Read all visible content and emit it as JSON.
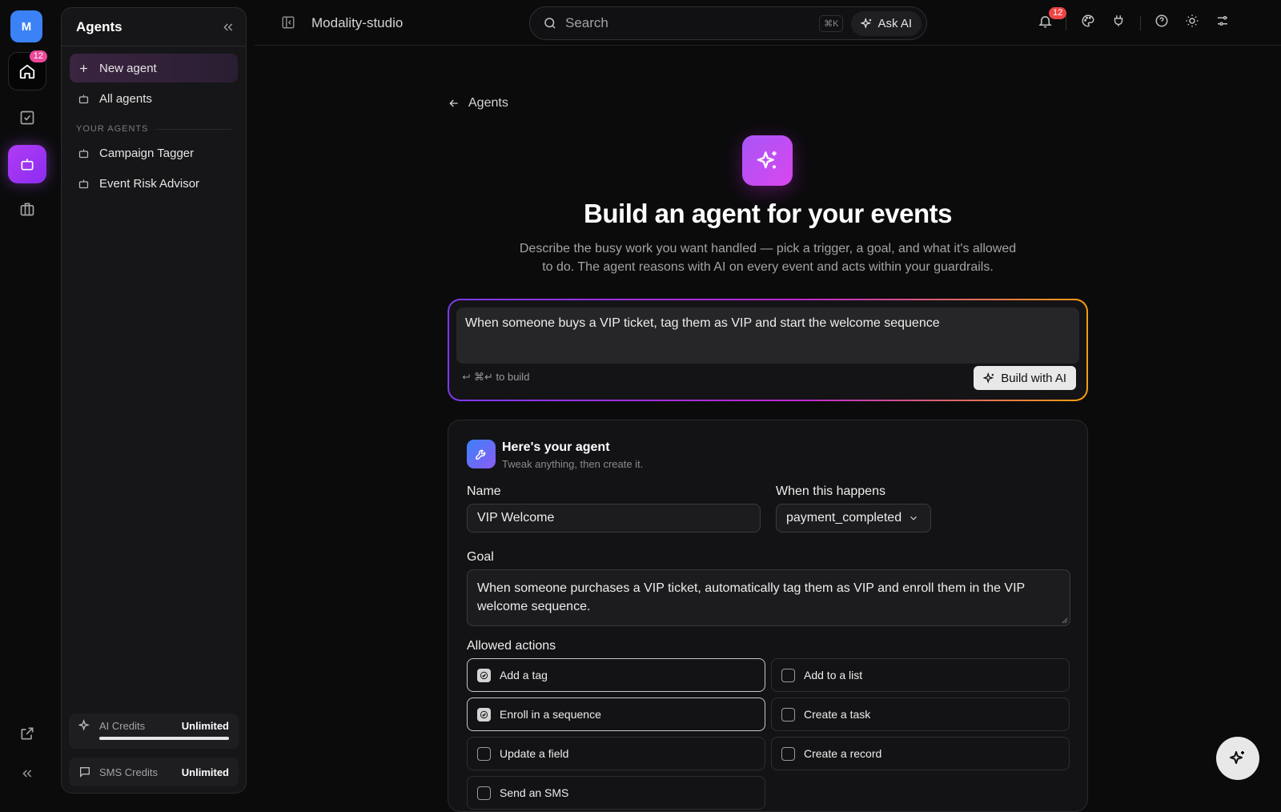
{
  "rail": {
    "avatar_initial": "M",
    "home_badge": "12",
    "items": [
      "home-icon",
      "tasks-icon",
      "agents-icon",
      "briefcase-icon"
    ],
    "bottom": [
      "external-link-icon",
      "collapse-icon"
    ]
  },
  "sidebar": {
    "title": "Agents",
    "new_agent": "New agent",
    "all_agents": "All agents",
    "section_label": "YOUR AGENTS",
    "agents": [
      "Campaign Tagger",
      "Event Risk Advisor"
    ],
    "credits": [
      {
        "label": "AI Credits",
        "value": "Unlimited",
        "progress": 1.0
      },
      {
        "label": "SMS Credits",
        "value": "Unlimited"
      }
    ]
  },
  "header": {
    "workspace": "Modality-studio",
    "search_placeholder": "Search",
    "shortcut": "⌘K",
    "ask_ai": "Ask AI",
    "notification_count": "12"
  },
  "main": {
    "back_label": "Agents",
    "title": "Build an agent for your events",
    "subtitle": "Describe the busy work you want handled — pick a trigger, a goal, and what it's allowed to do. The agent reasons with AI on every event and acts within your guardrails.",
    "prompt_text": "When someone buys a VIP ticket, tag them as VIP and start the welcome sequence",
    "prompt_hint": "⌘↵ to build",
    "build_button": "Build with AI"
  },
  "agent_card": {
    "title": "Here's your agent",
    "subtitle": "Tweak anything, then create it.",
    "name_label": "Name",
    "name_value": "VIP Welcome",
    "trigger_label": "When this happens",
    "trigger_value": "payment_completed",
    "goal_label": "Goal",
    "goal_value": "When someone purchases a VIP ticket, automatically tag them as VIP and enroll them in the VIP welcome sequence.",
    "actions_label": "Allowed actions",
    "actions": [
      {
        "label": "Add a tag",
        "checked": true
      },
      {
        "label": "Add to a list",
        "checked": false
      },
      {
        "label": "Enroll in a sequence",
        "checked": true
      },
      {
        "label": "Create a task",
        "checked": false
      },
      {
        "label": "Update a field",
        "checked": false
      },
      {
        "label": "Create a record",
        "checked": false
      },
      {
        "label": "Send an SMS",
        "checked": false
      }
    ]
  },
  "colors": {
    "accent": "#a855f7",
    "badge": "#ec4899",
    "background": "#0b0b0c"
  }
}
